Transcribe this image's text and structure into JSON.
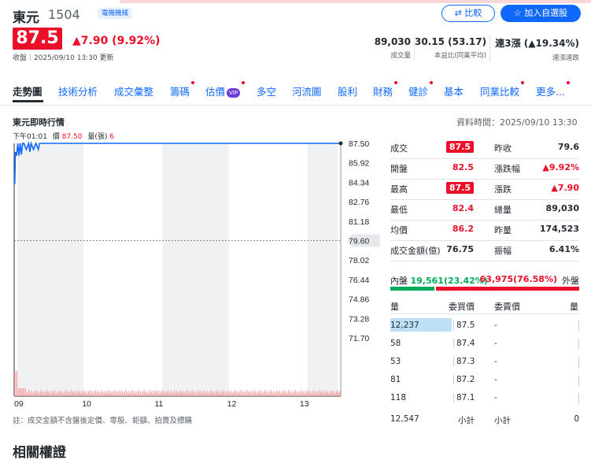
{
  "header": {
    "name": "東元",
    "code": "1504",
    "tag": "電機機械",
    "compare_label": "比較",
    "watchlist_label": "加入自選股",
    "price": "87.5",
    "change": "▲7.90 (9.92%)",
    "updated": "收盤｜2025/09/10 13:30 更新"
  },
  "stats": [
    {
      "value": "89,030",
      "label": "成交量"
    },
    {
      "value": "30.15 (53.17)",
      "label": "本益比(同業平均)"
    },
    {
      "value": "連3漲 (▲19.34%)",
      "label": "連漲連跌"
    }
  ],
  "tabs": [
    {
      "label": "走勢圖",
      "active": true,
      "dot": false
    },
    {
      "label": "技術分析",
      "dot": false
    },
    {
      "label": "成交彙整",
      "dot": false
    },
    {
      "label": "籌碼",
      "dot": true
    },
    {
      "label": "估價",
      "dot": true,
      "vip": "VIP"
    },
    {
      "label": "多空",
      "dot": false
    },
    {
      "label": "河流圖",
      "dot": false
    },
    {
      "label": "股利",
      "dot": false
    },
    {
      "label": "財務",
      "dot": true
    },
    {
      "label": "健診",
      "dot": true
    },
    {
      "label": "基本",
      "dot": false
    },
    {
      "label": "同業比較",
      "dot": true
    },
    {
      "label": "更多...",
      "dot": true
    }
  ],
  "chart_section": {
    "title": "東元即時行情",
    "data_time": "資料時間：2025/09/10 13:30",
    "legend_time": "下午01:01",
    "legend_price_label": "價",
    "legend_price": "87.50",
    "legend_vol_label": "量(張)",
    "legend_vol": "6",
    "footnote": "註：成交金額不含盤後定價、零股、鉅額、拍賣及標購"
  },
  "chart_data": {
    "type": "line",
    "x_ticks": [
      "09",
      "10",
      "11",
      "12",
      "13"
    ],
    "y_ticks": [
      "87.50",
      "85.92",
      "84.34",
      "82.76",
      "81.18",
      "79.60",
      "78.02",
      "76.44",
      "74.86",
      "73.28",
      "71.70"
    ],
    "ylim": [
      71.7,
      87.5
    ],
    "reference_price": 79.6,
    "series": [
      {
        "values": [
          [
            0,
            84.4
          ],
          [
            0.5,
            84.2
          ],
          [
            1,
            86.8
          ],
          [
            2,
            86.5
          ],
          [
            3,
            87.5
          ],
          [
            4,
            86.5
          ],
          [
            5,
            87.5
          ],
          [
            6,
            86.6
          ],
          [
            7,
            87.5
          ],
          [
            8,
            87.5
          ],
          [
            10,
            87.0
          ],
          [
            12,
            87.5
          ],
          [
            13,
            86.8
          ],
          [
            14,
            87.5
          ],
          [
            16,
            87.0
          ],
          [
            18,
            87.5
          ],
          [
            20,
            87.0
          ],
          [
            21,
            87.5
          ],
          [
            24,
            87.5
          ],
          [
            30,
            87.5
          ],
          [
            60,
            87.5
          ],
          [
            120,
            87.5
          ],
          [
            180,
            87.5
          ],
          [
            240,
            87.5
          ],
          [
            270,
            87.5
          ]
        ]
      }
    ],
    "volume_note": "per-minute volume bars along bottom"
  },
  "quote": {
    "rows": [
      {
        "l1": "成交",
        "v1": "87.5",
        "v1_style": "box",
        "l2": "昨收",
        "v2": "79.6",
        "v2_style": "plain"
      },
      {
        "l1": "開盤",
        "v1": "82.5",
        "v1_style": "red",
        "l2": "漲跌幅",
        "v2": "▲9.92%",
        "v2_style": "red"
      },
      {
        "l1": "最高",
        "v1": "87.5",
        "v1_style": "box",
        "l2": "漲跌",
        "v2": "▲7.90",
        "v2_style": "red"
      },
      {
        "l1": "最低",
        "v1": "82.4",
        "v1_style": "red",
        "l2": "總量",
        "v2": "89,030",
        "v2_style": "plain"
      },
      {
        "l1": "均價",
        "v1": "86.2",
        "v1_style": "red",
        "l2": "昨量",
        "v2": "174,523",
        "v2_style": "plain"
      },
      {
        "l1": "成交金額(億)",
        "v1": "76.75",
        "v1_style": "plain",
        "l2": "振幅",
        "v2": "6.41%",
        "v2_style": "plain"
      }
    ],
    "inner_label": "內盤",
    "inner_value": "19,561(23.42%)",
    "outer_value": "63,975(76.58%)",
    "outer_label": "外盤",
    "inner_ratio": 0.2342
  },
  "orderbook": {
    "head_vol": "量",
    "head_bid": "委買價",
    "head_ask": "委賣價",
    "head_ask_vol": "量",
    "rows": [
      {
        "vol": "12,237",
        "bid": "87.5",
        "ask": "-",
        "highlight": true
      },
      {
        "vol": "58",
        "bid": "87.4",
        "ask": "-"
      },
      {
        "vol": "53",
        "bid": "87.3",
        "ask": "-"
      },
      {
        "vol": "81",
        "bid": "87.2",
        "ask": "-"
      },
      {
        "vol": "118",
        "bid": "87.1",
        "ask": "-"
      }
    ],
    "total_bid": "12,547",
    "subtotal_label": "小計",
    "total_ask_label": "小計",
    "total_ask": "0"
  },
  "section_title": "相關權證"
}
